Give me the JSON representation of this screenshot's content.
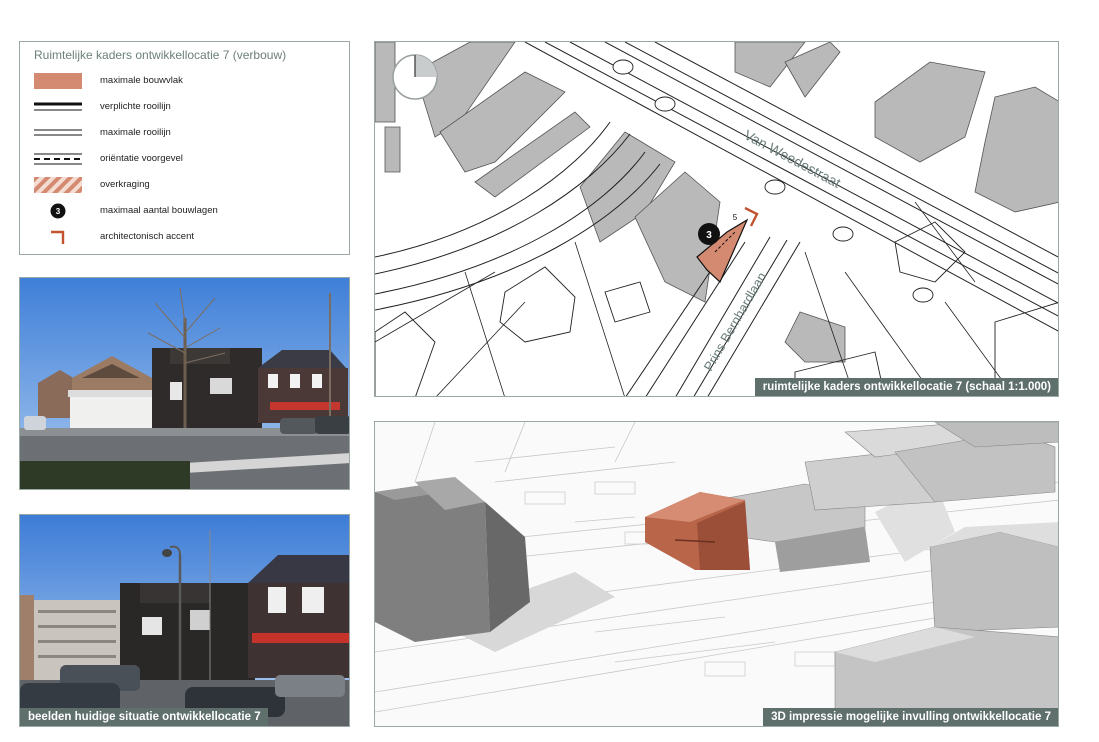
{
  "legend": {
    "title": "Ruimtelijke kaders ontwikkellocatie 7 (verbouw)",
    "items": [
      {
        "label": "maximale bouwvlak",
        "symbol": "filled-rect"
      },
      {
        "label": "verplichte rooilijn",
        "symbol": "thick-double-line"
      },
      {
        "label": "maximale rooilijn",
        "symbol": "thin-double-line"
      },
      {
        "label": "oriëntatie voorgevel",
        "symbol": "dashed-line"
      },
      {
        "label": "overkraging",
        "symbol": "hatched-rect"
      },
      {
        "label": "maximaal aantal bouwlagen",
        "symbol": "black-circle-3"
      },
      {
        "label": "architectonisch accent",
        "symbol": "corner-mark"
      }
    ],
    "circle_number": "3"
  },
  "map": {
    "caption": "ruimtelijke kaders ontwikkellocatie 7 (schaal 1:1.000)",
    "street_1": "Van Weedestraat",
    "street_2": "Prins Bernhardlaan",
    "layer_count": "3",
    "small_label": "5",
    "north_arrow": "north-arrow-icon"
  },
  "view3d": {
    "caption": "3D impressie mogelijke invulling ontwikkellocatie 7"
  },
  "photos": {
    "caption": "beelden huidige situatie ontwikkellocatie 7"
  },
  "colors": {
    "building_plot": "#d48a70",
    "accent": "#c2532e",
    "caption_bg": "#5e6f6c",
    "building_gray": "#b9b9b9",
    "frame": "#9aa9a6"
  }
}
